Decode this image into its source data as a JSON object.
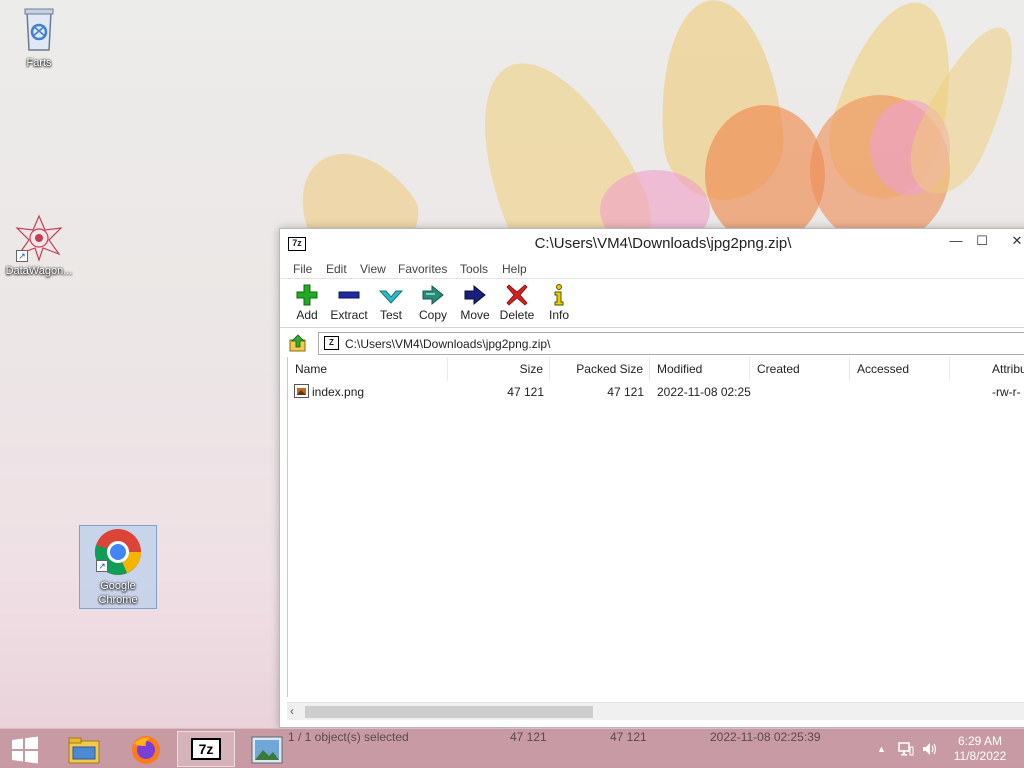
{
  "desktop": {
    "icons": [
      {
        "label": "Farts"
      },
      {
        "label": "DataWagon..."
      },
      {
        "label": "Google Chrome"
      }
    ]
  },
  "window": {
    "title": "C:\\Users\\VM4\\Downloads\\jpg2png.zip\\",
    "app_icon_text": "7z",
    "controls": {
      "minimize": "—",
      "maximize": "☐",
      "close": "✕"
    },
    "menu": [
      "File",
      "Edit",
      "View",
      "Favorites",
      "Tools",
      "Help"
    ],
    "toolbar": [
      {
        "label": "Add",
        "icon": "plus-icon",
        "color": "#22aa22"
      },
      {
        "label": "Extract",
        "icon": "minus-icon",
        "color": "#1f2a9e"
      },
      {
        "label": "Test",
        "icon": "check-arrow-icon",
        "color": "#2bbac0"
      },
      {
        "label": "Copy",
        "icon": "double-arrow-right-icon",
        "color": "#2a8a78"
      },
      {
        "label": "Move",
        "icon": "arrow-right-icon",
        "color": "#1a1f7a"
      },
      {
        "label": "Delete",
        "icon": "x-icon",
        "color": "#d42020"
      },
      {
        "label": "Info",
        "icon": "info-icon",
        "color": "#c9b400"
      }
    ],
    "address": {
      "path": "C:\\Users\\VM4\\Downloads\\jpg2png.zip\\"
    },
    "columns": [
      "Name",
      "Size",
      "Packed Size",
      "Modified",
      "Created",
      "Accessed",
      "Attribu"
    ],
    "rows": [
      {
        "name": "index.png",
        "size": "47 121",
        "packed_size": "47 121",
        "modified": "2022-11-08 02:25",
        "created": "",
        "accessed": "",
        "attributes": "-rw-r-"
      }
    ],
    "status": {
      "selection": "1 / 1 object(s) selected",
      "size": "47 121",
      "packed": "47 121",
      "modified": "2022-11-08 02:25:39"
    }
  },
  "taskbar": {
    "apps": [
      "start",
      "file-explorer",
      "firefox",
      "7-zip",
      "image-viewer"
    ],
    "tray": {
      "expand": "▲"
    },
    "clock": {
      "time": "6:29 AM",
      "date": "11/8/2022"
    }
  }
}
